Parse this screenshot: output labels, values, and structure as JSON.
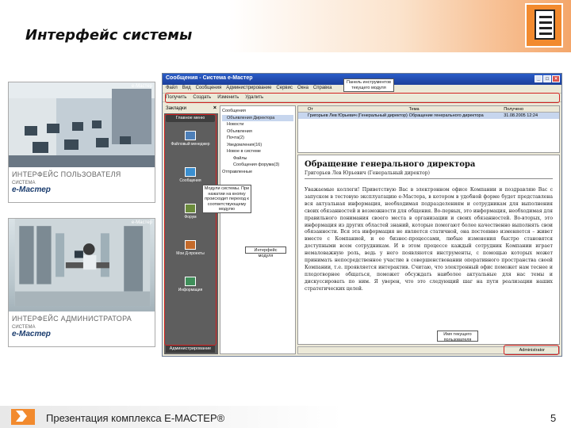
{
  "header": {
    "title": "Интерфейс системы"
  },
  "icons": {
    "slide_icon": "document-icon",
    "footer_icon": "chevron-right-icon"
  },
  "colors": {
    "accent": "#f28a2e",
    "highlight": "#d32020"
  },
  "photos": [
    {
      "brand": "e-Мастер",
      "caption": "ИНТЕРФЕЙС ПОЛЬЗОВАТЕЛЯ",
      "system": "СИСТЕМА",
      "product": "e-Мастер"
    },
    {
      "brand": "e-Мастер",
      "caption": "ИНТЕРФЕЙС АДМИНИСТРАТОРА",
      "system": "СИСТЕМА",
      "product": "e-Мастер"
    }
  ],
  "window": {
    "title": "Сообщения - Система e-Мастер",
    "menu": [
      "Файл",
      "Вид",
      "Сообщения",
      "Администрирование",
      "Сервис",
      "Окна",
      "Справка"
    ],
    "toolbar": [
      "Получить",
      "Создать",
      "Изменить",
      "Удалить"
    ],
    "left_head": "Закладки",
    "left_top": "Главное меню",
    "left_items": [
      "Файловый менеджер",
      "Сообщения",
      "Форум",
      "Мои Д-проекты",
      "Информация"
    ],
    "left_bottom": "Администрирование",
    "tree": [
      "Сообщения",
      "Объявления Директора",
      "Новости",
      "Объявления",
      "Почта(2)",
      "Уведомления(16)",
      "Новое в системе",
      "Файлы",
      "Сообщения форума(3)",
      "Отправленные"
    ],
    "list_headers": [
      "От",
      "Тема",
      "Получено"
    ],
    "list_row": [
      "Григорьев Лев Юрьевич (Генеральный директор)",
      "Обращение генерального директора",
      "31.08.2005 12:24"
    ],
    "preview_title": "Обращение генерального директора",
    "preview_from": "Григорьев Лев Юрьевич (Генеральный директор)",
    "preview_body": "Уважаемые коллеги! Приветствую Вас в электронном офисе Компании и поздравляю Вас с запуском в тестовую эксплуатацию е-Мастера, в котором в удобной форме будет представлена вся актуальная информация, необходимая подразделениям и сотрудникам для выполнения своих обязанностей и возможности для общения. Во-первых, это информация, необходимая для правильного понимания своего места в организации и своих обязанностей. Во-вторых, это информация из других областей знаний, которые помогают более качественно выполнять свои обязанности. Вся эта информация не является статичной, она постоянно изменяется – живет вместе с Компанией, и ее бизнес-процессами, любые изменения быстро становятся доступными всем сотрудникам. И в этом процессе каждый сотрудник Компании играет немаловажную роль, ведь у него появляются инструменты, с помощью которых может принимать непосредственное участие в совершенствовании оперативного пространства своей Компании, т.е. проявляется интерактив. Считаю, что электронный офис поможет нам теснее и плодотворнее общаться, поможет обсуждать наиболее актуальные для нас темы и дискуссировать по ним. Я уверен, что это следующий шаг на пути реализации наших стратегических целей.",
    "status": "Administrator"
  },
  "callouts": {
    "toolbar": "Панель инструментов текущего модуля",
    "modules": "Модули системы. При нажатии на кнопку происходит переход к соответствующему модулю",
    "module_ui": "Интерфейс модуля",
    "user": "Имя текущего пользователя"
  },
  "footer": {
    "text": "Презентация комплекса Е-МАСТЕР®",
    "page": "5"
  }
}
